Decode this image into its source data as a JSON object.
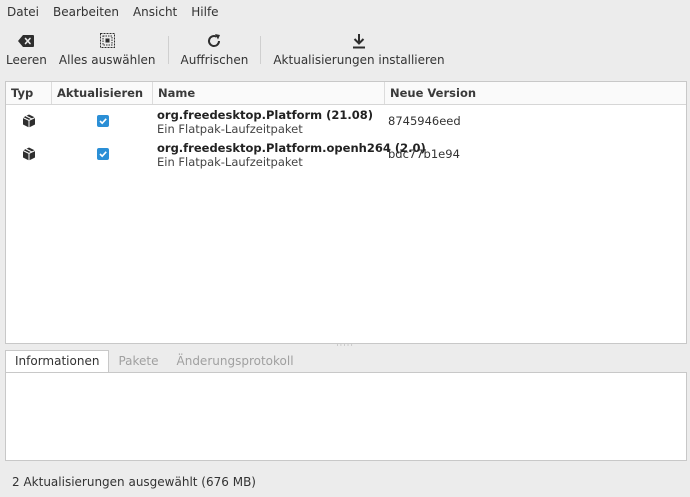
{
  "menubar": {
    "items": [
      "Datei",
      "Bearbeiten",
      "Ansicht",
      "Hilfe"
    ]
  },
  "toolbar": {
    "clear_label": "Leeren",
    "select_all_label": "Alles auswählen",
    "refresh_label": "Auffrischen",
    "install_label": "Aktualisierungen installieren"
  },
  "table": {
    "headers": {
      "type": "Typ",
      "update": "Aktualisieren",
      "name": "Name",
      "version": "Neue Version"
    },
    "rows": [
      {
        "icon": "package-icon",
        "checked": true,
        "name": "org.freedesktop.Platform (21.08)",
        "description": "Ein Flatpak-Laufzeitpaket",
        "version": "8745946eed"
      },
      {
        "icon": "package-icon",
        "checked": true,
        "name": "org.freedesktop.Platform.openh264 (2.0)",
        "description": "Ein Flatpak-Laufzeitpaket",
        "version": "bdc77b1e94"
      }
    ]
  },
  "tabs": {
    "info": "Informationen",
    "packages": "Pakete",
    "changelog": "Änderungsprotokoll",
    "active": "Informationen"
  },
  "status": {
    "text": "2 Aktualisierungen ausgewählt (676 MB)"
  },
  "colors": {
    "checkbox": "#2b8fd6",
    "background": "#ececec"
  }
}
